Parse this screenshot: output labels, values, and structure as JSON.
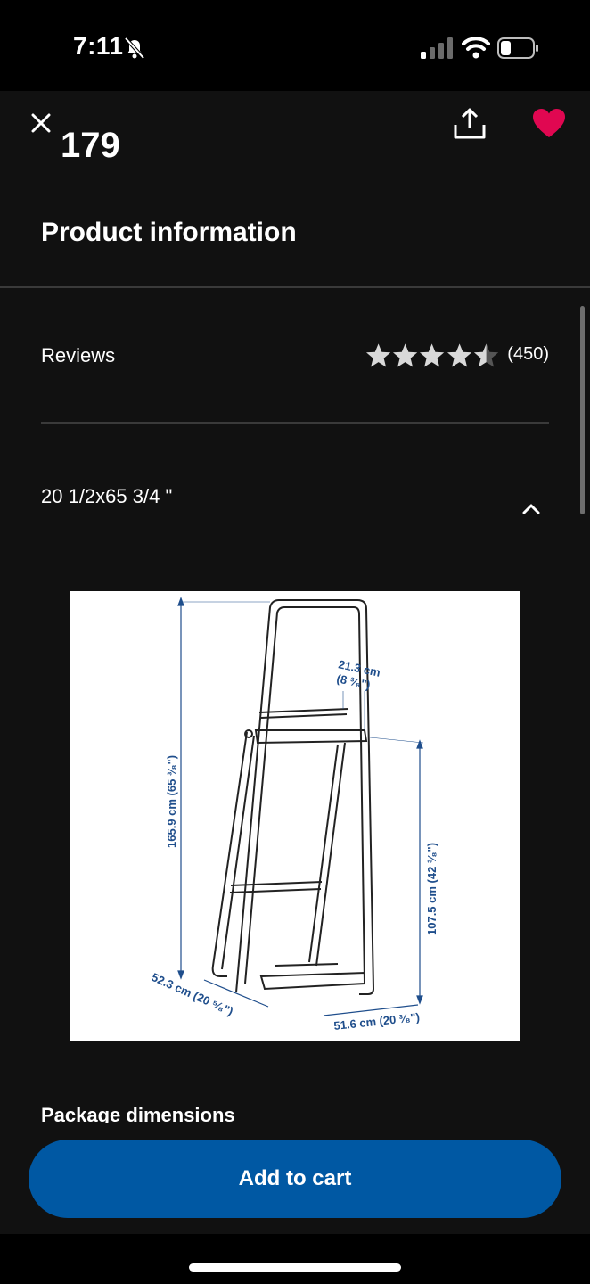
{
  "status_bar": {
    "time": "7:11"
  },
  "header": {
    "price_fragment": "179"
  },
  "product_info": {
    "title": "Product information",
    "reviews": {
      "label": "Reviews",
      "rating": 4.5,
      "max_rating": 5,
      "count": "(450)"
    },
    "size": {
      "label": "20 1/2x65 3/4 \""
    },
    "diagram_labels": {
      "height_total": "165.9 cm (65 ³⁄₈\")",
      "depth_top_cm": "21.3 cm",
      "depth_top_in": "(8 ³⁄₈\")",
      "height_shelf": "107.5 cm (42 ³⁄₈\")",
      "depth_base": "52.3 cm (20 ⁵⁄₈\")",
      "width_base": "51.6 cm (20 ³⁄₈\")"
    },
    "package_title": "Package dimensions"
  },
  "actions": {
    "add_to_cart": "Add to cart"
  },
  "colors": {
    "accent": "#0058a3",
    "heart": "#e00751",
    "background": "#111111",
    "diagram_text": "#1f4e8c"
  }
}
